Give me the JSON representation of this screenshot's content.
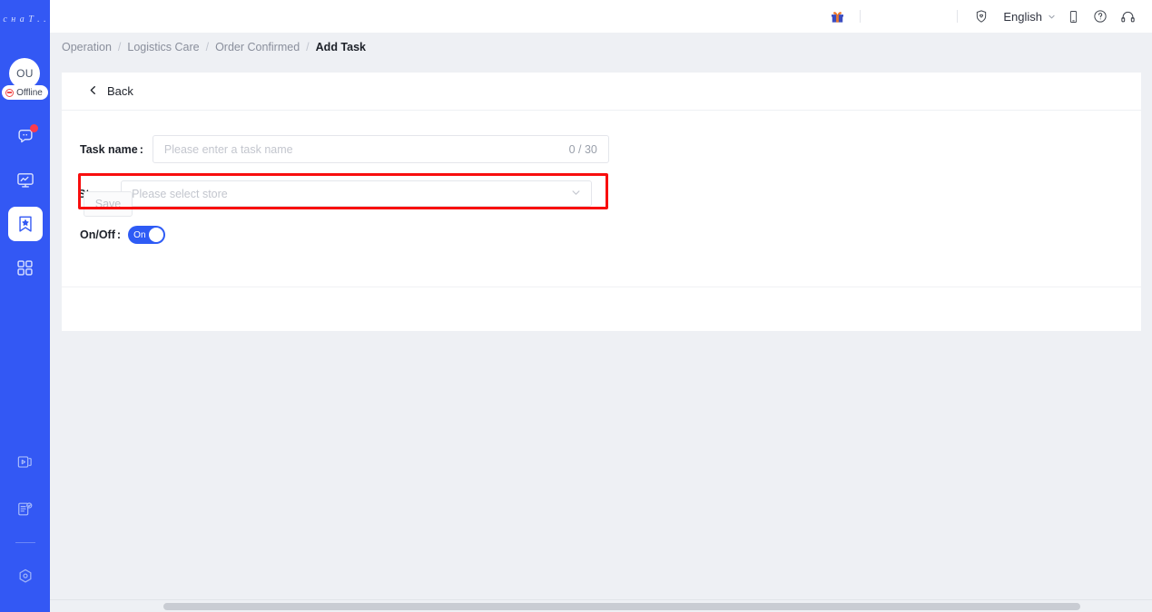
{
  "brand": {
    "logo_text": "c н a T . .",
    "sidebar_color": "#3358f4"
  },
  "sidebar": {
    "avatar_initials": "OU",
    "status_label": "Offline",
    "nav_items": [
      {
        "name": "chat",
        "icon": "chat-bubble-icon",
        "badge": true,
        "active": false
      },
      {
        "name": "monitor",
        "icon": "monitor-chart-icon",
        "badge": false,
        "active": false
      },
      {
        "name": "operation",
        "icon": "bookmark-star-icon",
        "badge": false,
        "active": true
      },
      {
        "name": "apps",
        "icon": "grid-apps-icon",
        "badge": false,
        "active": false
      }
    ],
    "bottom_items": [
      {
        "name": "media",
        "icon": "video-play-icon"
      },
      {
        "name": "announcement",
        "icon": "document-bell-icon"
      },
      {
        "name": "settings",
        "icon": "hex-gear-icon"
      }
    ]
  },
  "topbar": {
    "gift_icon": "gift-icon",
    "shield_icon": "shield-heart-icon",
    "language_label": "English",
    "chevron_icon": "chevron-down-icon",
    "mobile_icon": "mobile-phone-icon",
    "help_icon": "question-circle-icon",
    "support_icon": "headset-icon"
  },
  "breadcrumb": {
    "items": [
      {
        "label": "Operation",
        "current": false
      },
      {
        "label": "Logistics Care",
        "current": false
      },
      {
        "label": "Order Confirmed",
        "current": false
      },
      {
        "label": "Add Task",
        "current": true
      }
    ],
    "separator": "/"
  },
  "back_bar": {
    "label": "Back",
    "icon": "chevron-left-icon"
  },
  "form": {
    "task_name": {
      "label": "Task name",
      "colon": ":",
      "value": "",
      "placeholder": "Please enter a task name",
      "counter": "0 / 30"
    },
    "store": {
      "label": "Store",
      "colon": ":",
      "value": "",
      "placeholder": "Please select store",
      "chevron_icon": "chevron-down-icon",
      "highlight_color": "#f80e0e",
      "highlighted": true
    },
    "on_off": {
      "label": "On/Off",
      "colon": ":",
      "state_label": "On",
      "enabled": true,
      "on_color": "#2e5bf5"
    }
  },
  "footer": {
    "save_label": "Save",
    "save_enabled": false
  }
}
